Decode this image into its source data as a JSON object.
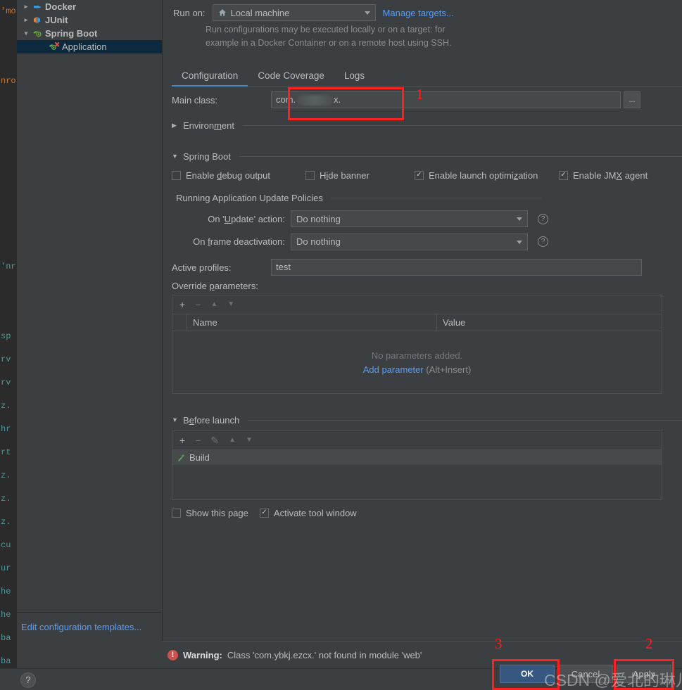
{
  "background_editor": {
    "lines": [
      "'mo",
      "",
      "",
      "nro",
      "",
      "",
      "",
      "",
      "",
      "",
      "",
      "'nr",
      "",
      "",
      "sp",
      "rv",
      "rv",
      "z.",
      "hr",
      "rt",
      "z.",
      "z.",
      "z.",
      "cu",
      "ur",
      "he",
      "he",
      "ba",
      "ba"
    ]
  },
  "tree": {
    "items": [
      {
        "label": "Docker",
        "twisty": "›",
        "icon": "docker-icon",
        "bold": true,
        "indent": 0,
        "selected": false
      },
      {
        "label": "JUnit",
        "twisty": "›",
        "icon": "junit-icon",
        "bold": true,
        "indent": 0,
        "selected": false
      },
      {
        "label": "Spring Boot",
        "twisty": "⌄",
        "icon": "spring-icon",
        "bold": true,
        "indent": 0,
        "selected": false
      },
      {
        "label": "Application",
        "twisty": "",
        "icon": "spring-app-error-icon",
        "bold": false,
        "indent": 1,
        "selected": true
      }
    ],
    "edit_templates_link": "Edit configuration templates..."
  },
  "run_on": {
    "label": "Run on:",
    "value": "Local machine",
    "icon": "home-icon",
    "manage_targets_link": "Manage targets...",
    "hint_line1": "Run configurations may be executed locally or on a target: for",
    "hint_line2": "example in a Docker Container or on a remote host using SSH."
  },
  "tabs": [
    {
      "label": "Configuration",
      "active": true
    },
    {
      "label": "Code Coverage",
      "active": false
    },
    {
      "label": "Logs",
      "active": false
    }
  ],
  "main_class": {
    "label": "Main class:",
    "value_prefix": "com.",
    "value_suffix": "x.",
    "browse_label": "..."
  },
  "environment": {
    "title_pre": "Environ",
    "title_mnemonic": "m",
    "title_post": "ent",
    "expanded": false
  },
  "spring_boot": {
    "title_pre": "Sprin",
    "title_mnemonic": "g",
    "title_post": " Boot",
    "expanded": true,
    "checkboxes": [
      {
        "label_pre": "Enable ",
        "mnemonic": "d",
        "label_post": "ebug output",
        "checked": false,
        "name": "enable-debug-output"
      },
      {
        "label_pre": "H",
        "mnemonic": "i",
        "label_post": "de banner",
        "checked": false,
        "name": "hide-banner"
      },
      {
        "label_pre": "Enable launch optimi",
        "mnemonic": "z",
        "label_post": "ation",
        "checked": true,
        "name": "enable-launch-optimization"
      },
      {
        "label_pre": "Enable JM",
        "mnemonic": "X",
        "label_post": " agent",
        "checked": true,
        "name": "enable-jmx-agent"
      }
    ],
    "update_policies_title": "Running Application Update Policies",
    "on_update": {
      "label_pre": "On '",
      "mnemonic": "U",
      "label_post": "pdate' action:",
      "value": "Do nothing"
    },
    "on_frame": {
      "label_pre": "On ",
      "mnemonic": "f",
      "label_post": "rame deactivation:",
      "value": "Do nothing"
    },
    "help_glyph": "?"
  },
  "active_profiles": {
    "label": "Active profiles:",
    "value": "test"
  },
  "override_parameters": {
    "label_pre": "Override ",
    "label_mnemonic": "p",
    "label_post": "arameters:",
    "toolbar": {
      "add": "+",
      "remove": "−",
      "up": "▲",
      "down": "▼"
    },
    "columns": [
      "Name",
      "Value"
    ],
    "rows": [],
    "empty_text": "No parameters added.",
    "add_link": "Add parameter",
    "add_shortcut": "(Alt+Insert)"
  },
  "before_launch": {
    "title_pre": "B",
    "title_mnemonic": "e",
    "title_post": "fore launch",
    "expanded": true,
    "toolbar": {
      "add": "+",
      "remove": "−",
      "edit": "✎",
      "up": "▲",
      "down": "▼"
    },
    "tasks": [
      {
        "label": "Build",
        "icon": "build-hammer-icon"
      }
    ],
    "checkboxes": [
      {
        "label": "Show this page",
        "checked": false,
        "name": "show-this-page"
      },
      {
        "label": "Activate tool window",
        "checked": true,
        "name": "activate-tool-window"
      }
    ]
  },
  "warning": {
    "icon": "error-icon",
    "prefix": "Warning:",
    "message": "Class 'com.ybkj.ezcx.' not found in module 'web'"
  },
  "buttons": {
    "help": "?",
    "ok": "OK",
    "cancel": "Cancel",
    "apply": "Apply"
  },
  "annotations": {
    "n1": "1",
    "n2": "2",
    "n3": "3"
  },
  "watermark": {
    "text": "CSDN @爱北的琳儿"
  },
  "colors": {
    "dialog_bg": "#3c3f41",
    "editor_bg": "#2b2b2b",
    "accent_blue": "#589df6",
    "tab_underline": "#4a88c7",
    "ok_button": "#365880",
    "warning_red": "#c75450",
    "annotation_red": "#ff2020",
    "selection_blue": "#0d293e"
  }
}
